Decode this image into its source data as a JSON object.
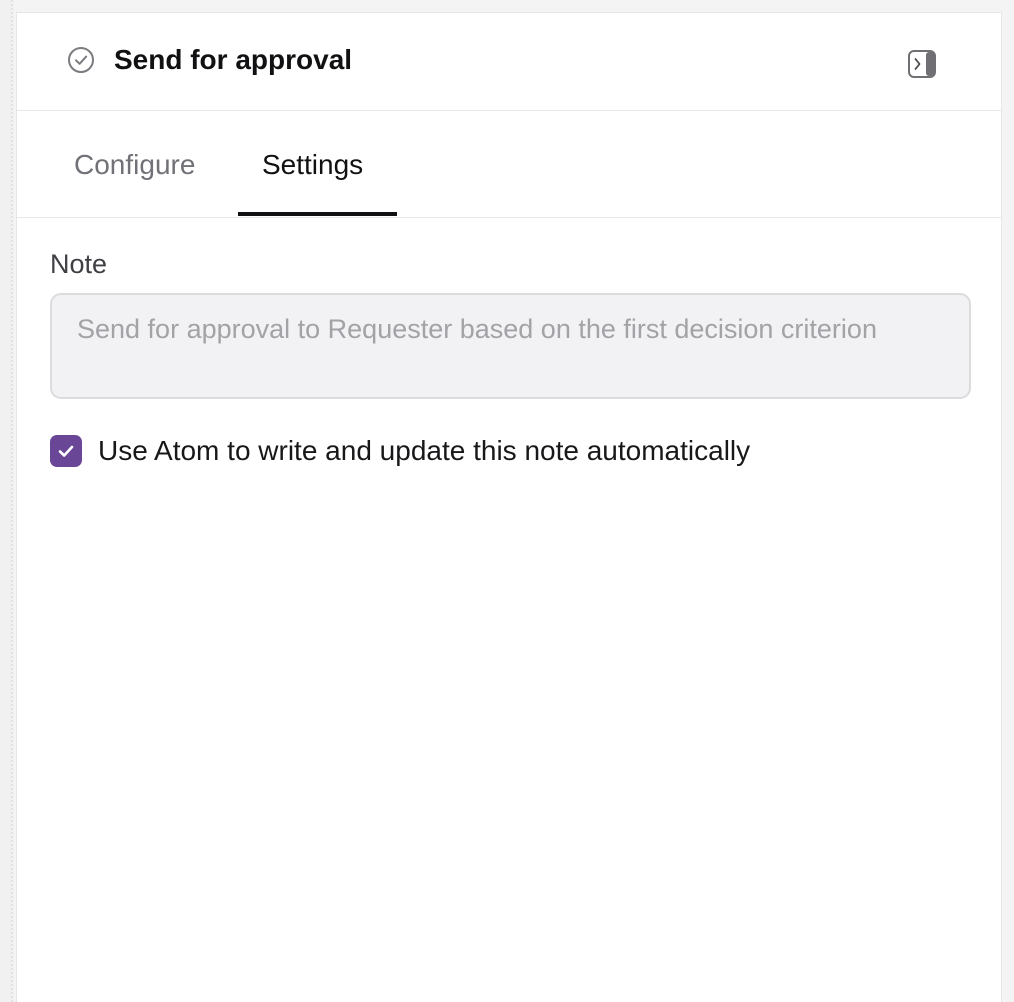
{
  "header": {
    "title": "Send for approval",
    "status_icon": "check-circle-icon",
    "collapse_icon": "panel-collapse-icon"
  },
  "tabs": [
    {
      "label": "Configure",
      "active": false
    },
    {
      "label": "Settings",
      "active": true
    }
  ],
  "settings": {
    "note_label": "Note",
    "note_value": "Send for approval to Requester based on the first decision criterion",
    "auto_note_label": "Use Atom to write and update this note automatically",
    "auto_note_checked": true
  },
  "colors": {
    "accent": "#6a4697",
    "text_primary": "#111113",
    "text_muted": "#717177",
    "field_bg": "#f2f2f4"
  }
}
